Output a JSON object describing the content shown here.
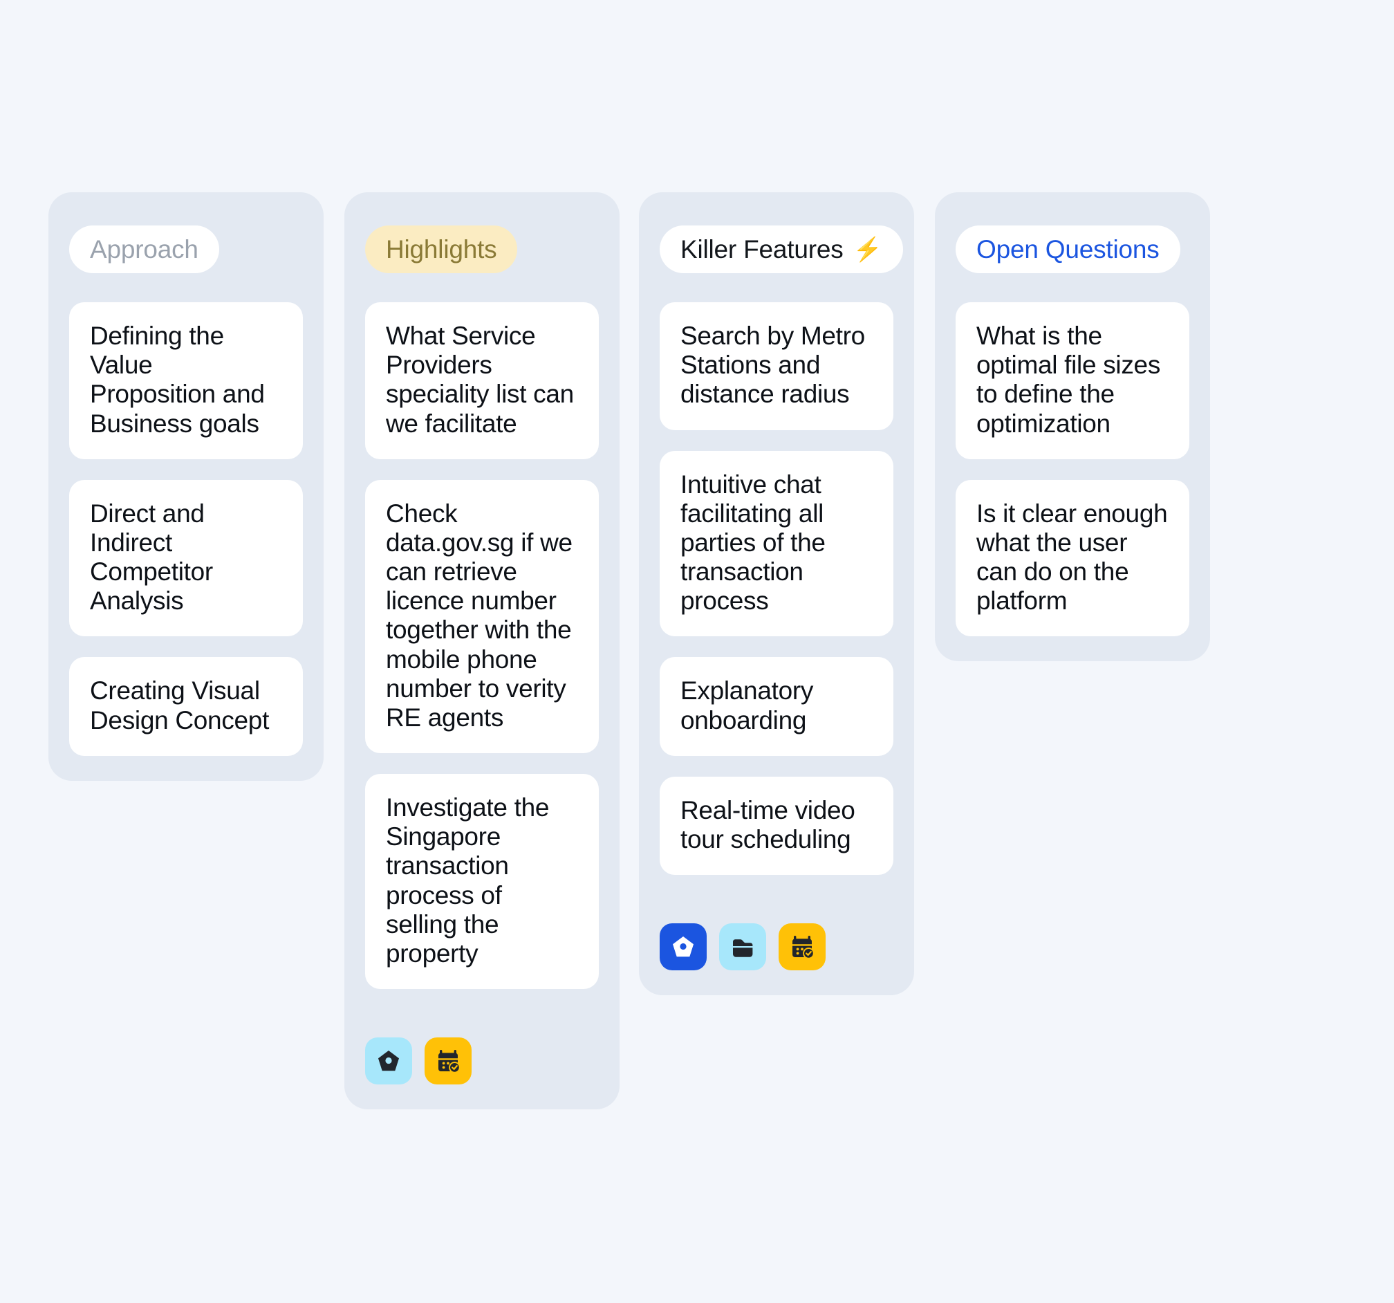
{
  "theme": {
    "page_background": "#f3f6fb",
    "column_background": "#e3e9f2",
    "card_background": "#ffffff",
    "card_text": "#0d1117",
    "accent_blue": "#1b55e0",
    "accent_yellow": "#ffc107",
    "accent_light_blue": "#a7e7fb",
    "pill_cream_bg": "#fbecc2",
    "pill_cream_text": "#8a7a36",
    "pill_muted_text": "#9aa2ad"
  },
  "columns": [
    {
      "id": "approach",
      "title": "Approach",
      "title_emoji": "",
      "pill_style": "white-muted",
      "cards": [
        {
          "text": "Defining the Value Proposition and Business goals"
        },
        {
          "text": "Direct and Indirect Competitor Analysis"
        },
        {
          "text": "Creating Visual Design Concept"
        }
      ],
      "icons": []
    },
    {
      "id": "highlights",
      "title": "Highlights",
      "title_emoji": "",
      "pill_style": "cream",
      "cards": [
        {
          "text": "What Service Providers speciality list can we facilitate"
        },
        {
          "text": "Check data.gov.sg if we can retrieve licence number together with the mobile phone number to verity RE agents"
        },
        {
          "text": "Investigate the Singapore transaction process of selling the property"
        }
      ],
      "icons": [
        {
          "name": "home-icon",
          "tile_color": "#a7e7fb",
          "glyph_color": "#22262c"
        },
        {
          "name": "calendar-check-icon",
          "tile_color": "#ffc107",
          "glyph_color": "#22262c"
        }
      ]
    },
    {
      "id": "killer-features",
      "title": "Killer Features",
      "title_emoji": "⚡",
      "pill_style": "white-black",
      "cards": [
        {
          "text": "Search by Metro Stations and distance radius"
        },
        {
          "text": "Intuitive chat facilitating all parties of the transaction process"
        },
        {
          "text": "Explanatory onboarding"
        },
        {
          "text": "Real-time video tour scheduling"
        }
      ],
      "icons": [
        {
          "name": "home-icon",
          "tile_color": "#1b55e0",
          "glyph_color": "#ffffff"
        },
        {
          "name": "folder-icon",
          "tile_color": "#a7e7fb",
          "glyph_color": "#22262c"
        },
        {
          "name": "calendar-check-icon",
          "tile_color": "#ffc107",
          "glyph_color": "#22262c"
        }
      ]
    },
    {
      "id": "open-questions",
      "title": "Open Questions",
      "title_emoji": "",
      "pill_style": "white-blue",
      "cards": [
        {
          "text": "What is the optimal file sizes to define the optimization"
        },
        {
          "text": "Is it clear enough what the user can do on the platform"
        }
      ],
      "icons": []
    }
  ]
}
